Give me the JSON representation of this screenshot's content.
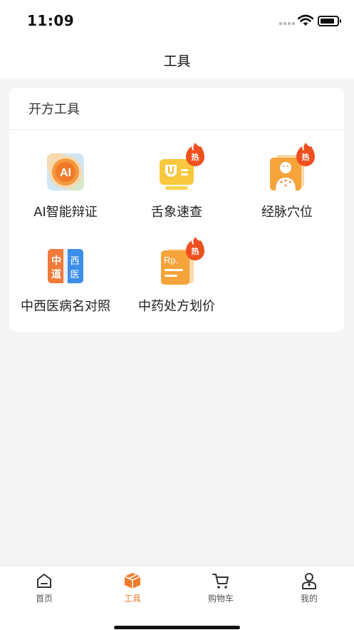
{
  "status_bar": {
    "time": "11:09"
  },
  "nav": {
    "title": "工具"
  },
  "section": {
    "title": "开方工具",
    "tools": [
      {
        "label": "AI智能辩证",
        "icon": "ai-diagnosis-icon",
        "hot": false
      },
      {
        "label": "舌象速查",
        "icon": "tongue-check-icon",
        "hot": true
      },
      {
        "label": "经脉穴位",
        "icon": "meridian-acupoint-icon",
        "hot": true
      },
      {
        "label": "中西医病名对照",
        "icon": "tcm-western-compare-icon",
        "hot": false
      },
      {
        "label": "中药处方划价",
        "icon": "prescription-pricing-icon",
        "hot": true
      }
    ],
    "hot_badge": "热"
  },
  "icon_text": {
    "ai": "AI",
    "zhong": "中",
    "dao": "道",
    "xi": "西",
    "yi": "医",
    "rp": "Rp."
  },
  "tabs": [
    {
      "label": "首页",
      "icon": "home-icon",
      "active": false
    },
    {
      "label": "工具",
      "icon": "tools-box-icon",
      "active": true
    },
    {
      "label": "购物车",
      "icon": "cart-icon",
      "active": false
    },
    {
      "label": "我的",
      "icon": "profile-icon",
      "active": false
    }
  ],
  "colors": {
    "accent": "#f07a2a",
    "hot_badge": "#ee4f1e"
  }
}
